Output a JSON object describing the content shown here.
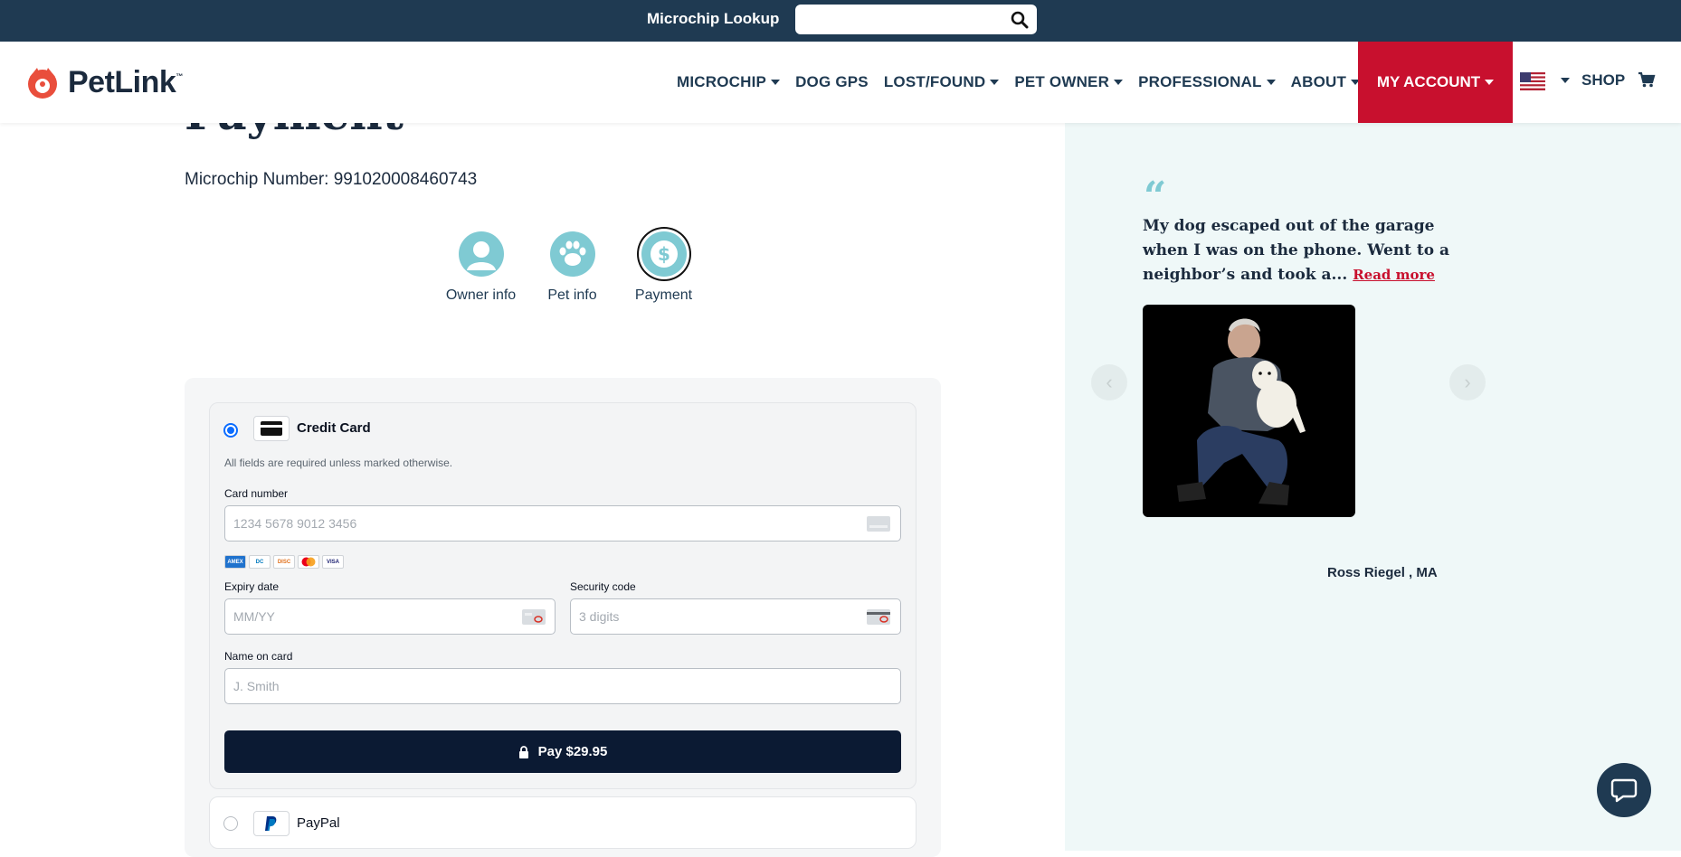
{
  "topbar": {
    "lookup_label": "Microchip Lookup",
    "lookup_placeholder": ""
  },
  "brand": {
    "name": "PetLink",
    "tm": "™"
  },
  "nav": {
    "items": [
      {
        "label": "MICROCHIP",
        "caret": true
      },
      {
        "label": "DOG GPS",
        "caret": false
      },
      {
        "label": "LOST/FOUND",
        "caret": true
      },
      {
        "label": "PET OWNER",
        "caret": true
      },
      {
        "label": "PROFESSIONAL",
        "caret": true
      },
      {
        "label": "ABOUT",
        "caret": true
      }
    ],
    "account": "MY ACCOUNT",
    "shop": "SHOP"
  },
  "page": {
    "title": "Payment",
    "microchip": "Microchip Number: 991020008460743"
  },
  "steps": [
    {
      "label": "Owner info",
      "icon": "person-icon"
    },
    {
      "label": "Pet info",
      "icon": "paw-icon"
    },
    {
      "label": "Payment",
      "icon": "dollar-icon"
    }
  ],
  "payment": {
    "credit_card": {
      "title": "Credit Card",
      "hint": "All fields are required unless marked otherwise.",
      "card_number_label": "Card number",
      "card_number_placeholder": "1234 5678 9012 3456",
      "brands": [
        "AMEX",
        "DC",
        "DISC",
        "MC",
        "VISA"
      ],
      "expiry_label": "Expiry date",
      "expiry_placeholder": "MM/YY",
      "security_label": "Security code",
      "security_placeholder": "3 digits",
      "name_label": "Name on card",
      "name_placeholder": "J. Smith",
      "pay_button": "Pay $29.95"
    },
    "paypal": {
      "title": "PayPal"
    }
  },
  "testimonial": {
    "quote": "My dog escaped out of the garage when I was on the phone. Went to a neighbor’s and took a...",
    "read_more": "Read more",
    "author": "Ross Riegel , MA"
  },
  "colors": {
    "navy": "#1f3a52",
    "accent_red": "#c8102e",
    "teal": "#7fcad3",
    "panel_bg": "#eff8f8"
  }
}
